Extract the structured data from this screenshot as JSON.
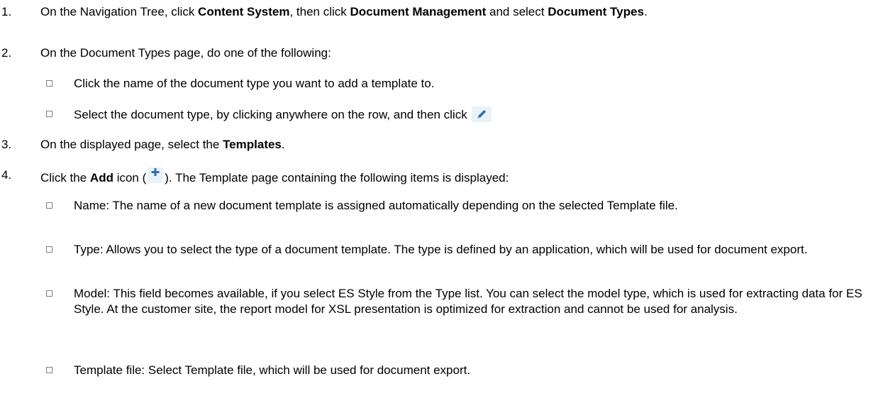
{
  "steps": [
    {
      "num": "1.",
      "t1": "On the Navigation Tree, click ",
      "b1": "Content System",
      "t2": ", then click ",
      "b2": "Document Management",
      "t3": " and select ",
      "b3": "Document Types",
      "t4": "."
    },
    {
      "num": "2.",
      "text": "On the Document Types page, do one of the following:"
    },
    {
      "num": "3.",
      "t1": "On the displayed page, select the ",
      "b1": "Templates",
      "t2": "."
    },
    {
      "num": "4.",
      "t1": "Click the ",
      "b1": "Add",
      "t2": " icon (",
      "t3": "). The Template page containing the following items is displayed:"
    }
  ],
  "step2_bullets": [
    "Click the name of the document type you want to add a template to.",
    "Select the document type, by clicking anywhere on the row, and then click"
  ],
  "step4_bullets": [
    "Name: The name of a new document template is assigned automatically depending on the selected Template file.",
    "Type: Allows you to select the type of a document template. The type is defined by an application, which will be used for document export.",
    "Model: This field becomes available, if you select ES Style from the Type list. You can select the model type, which is used for extracting data for ES Style. At the customer site, the report model for XSL presentation is optimized for extraction and cannot be used for analysis.",
    "Template file: Select Template file, which will be used for document export."
  ],
  "icons": {
    "edit": "pencil-edit-icon",
    "add": "plus-add-icon"
  },
  "colors": {
    "icon_blue": "#2e6db4",
    "icon_background": "#eaf2fb",
    "checkbox_border": "#7f7f7f"
  }
}
